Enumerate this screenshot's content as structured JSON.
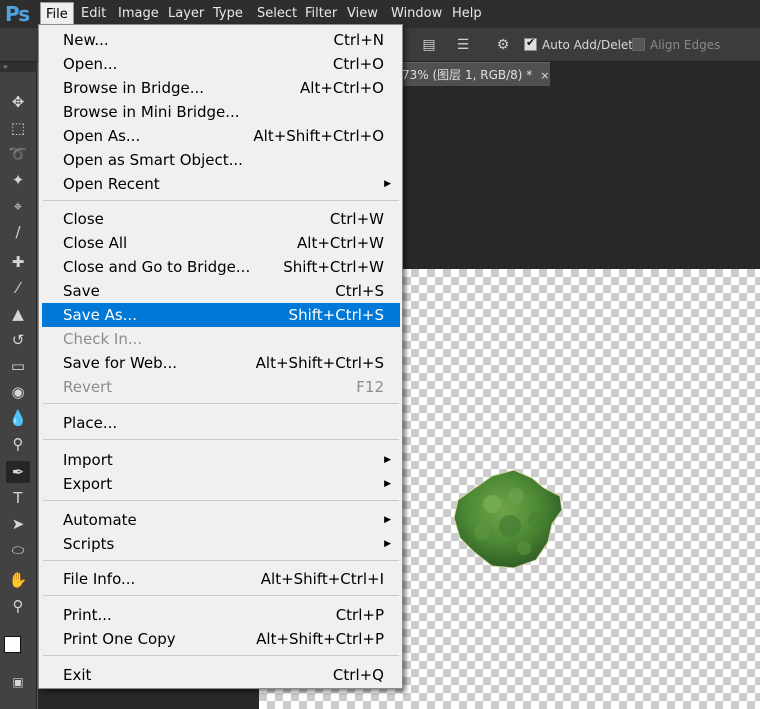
{
  "app": {
    "logo": "Ps"
  },
  "menubar": [
    "File",
    "Edit",
    "Image",
    "Layer",
    "Type",
    "Select",
    "Filter",
    "View",
    "Window",
    "Help"
  ],
  "options": {
    "auto_add_delete": "Auto Add/Delete",
    "align_edges": "Align Edges",
    "auto_add_checked": true,
    "align_edges_checked": false
  },
  "document": {
    "tab_title": "73% (图层 1, RGB/8) *",
    "tab_close": "×"
  },
  "file_menu": {
    "items": [
      {
        "label": "New...",
        "shortcut": "Ctrl+N"
      },
      {
        "label": "Open...",
        "shortcut": "Ctrl+O"
      },
      {
        "label": "Browse in Bridge...",
        "shortcut": "Alt+Ctrl+O"
      },
      {
        "label": "Browse in Mini Bridge...",
        "shortcut": ""
      },
      {
        "label": "Open As...",
        "shortcut": "Alt+Shift+Ctrl+O"
      },
      {
        "label": "Open as Smart Object...",
        "shortcut": ""
      },
      {
        "label": "Open Recent",
        "shortcut": "",
        "submenu": true
      },
      {
        "label": "Close",
        "shortcut": "Ctrl+W"
      },
      {
        "label": "Close All",
        "shortcut": "Alt+Ctrl+W"
      },
      {
        "label": "Close and Go to Bridge...",
        "shortcut": "Shift+Ctrl+W"
      },
      {
        "label": "Save",
        "shortcut": "Ctrl+S"
      },
      {
        "label": "Save As...",
        "shortcut": "Shift+Ctrl+S",
        "highlighted": true
      },
      {
        "label": "Check In...",
        "shortcut": "",
        "disabled": true
      },
      {
        "label": "Save for Web...",
        "shortcut": "Alt+Shift+Ctrl+S"
      },
      {
        "label": "Revert",
        "shortcut": "F12",
        "disabled": true
      },
      {
        "label": "Place...",
        "shortcut": ""
      },
      {
        "label": "Import",
        "shortcut": "",
        "submenu": true
      },
      {
        "label": "Export",
        "shortcut": "",
        "submenu": true
      },
      {
        "label": "Automate",
        "shortcut": "",
        "submenu": true
      },
      {
        "label": "Scripts",
        "shortcut": "",
        "submenu": true
      },
      {
        "label": "File Info...",
        "shortcut": "Alt+Shift+Ctrl+I"
      },
      {
        "label": "Print...",
        "shortcut": "Ctrl+P"
      },
      {
        "label": "Print One Copy",
        "shortcut": "Alt+Shift+Ctrl+P"
      },
      {
        "label": "Exit",
        "shortcut": "Ctrl+Q"
      }
    ]
  },
  "tools": [
    "move-tool-icon",
    "marquee-tool-icon",
    "lasso-tool-icon",
    "magic-wand-icon",
    "crop-tool-icon",
    "eyedropper-icon",
    "healing-brush-icon",
    "brush-tool-icon",
    "clone-stamp-icon",
    "history-brush-icon",
    "eraser-icon",
    "paint-bucket-icon",
    "blur-tool-icon",
    "dodge-tool-icon",
    "pen-tool-icon",
    "type-tool-icon",
    "path-selection-icon",
    "ellipse-tool-icon",
    "hand-tool-icon",
    "zoom-tool-icon"
  ],
  "colors": {
    "highlight": "#0078d7",
    "menu_bg": "#f0f0f0",
    "chrome": "#2e2e2e"
  }
}
